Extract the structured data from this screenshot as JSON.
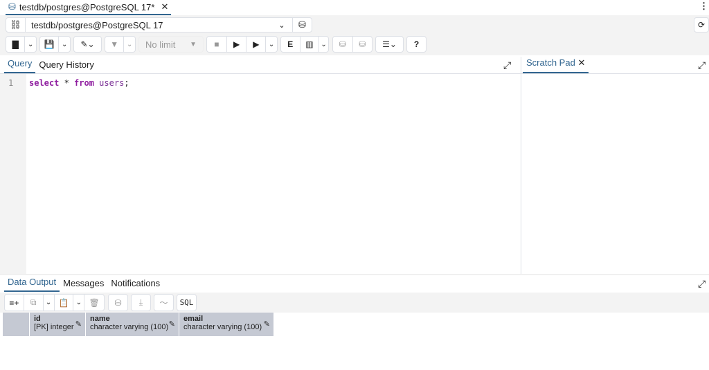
{
  "tab": {
    "title": "testdb/postgres@PostgreSQL 17*",
    "icon": "database-icon"
  },
  "connection": {
    "value": "testdb/postgres@PostgreSQL 17"
  },
  "toolbar": {
    "limit": "No limit"
  },
  "query_tabs": [
    {
      "label": "Query",
      "active": true
    },
    {
      "label": "Query History",
      "active": false
    }
  ],
  "editor": {
    "line_numbers": [
      "1"
    ],
    "tokens": {
      "k1": "select",
      "op": " * ",
      "k2": "from",
      "tbl": " users",
      "end": ";"
    }
  },
  "scratch": {
    "label": "Scratch Pad"
  },
  "result_tabs": [
    {
      "label": "Data Output",
      "active": true
    },
    {
      "label": "Messages"
    },
    {
      "label": "Notifications"
    }
  ],
  "result_toolbar": {
    "sql": "SQL"
  },
  "columns": [
    {
      "name": "id",
      "type": "[PK] integer"
    },
    {
      "name": "name",
      "type": "character varying (100)"
    },
    {
      "name": "email",
      "type": "character varying (100)"
    }
  ],
  "colors": {
    "accent": "#326690",
    "header_bg": "#c5c9d3"
  }
}
